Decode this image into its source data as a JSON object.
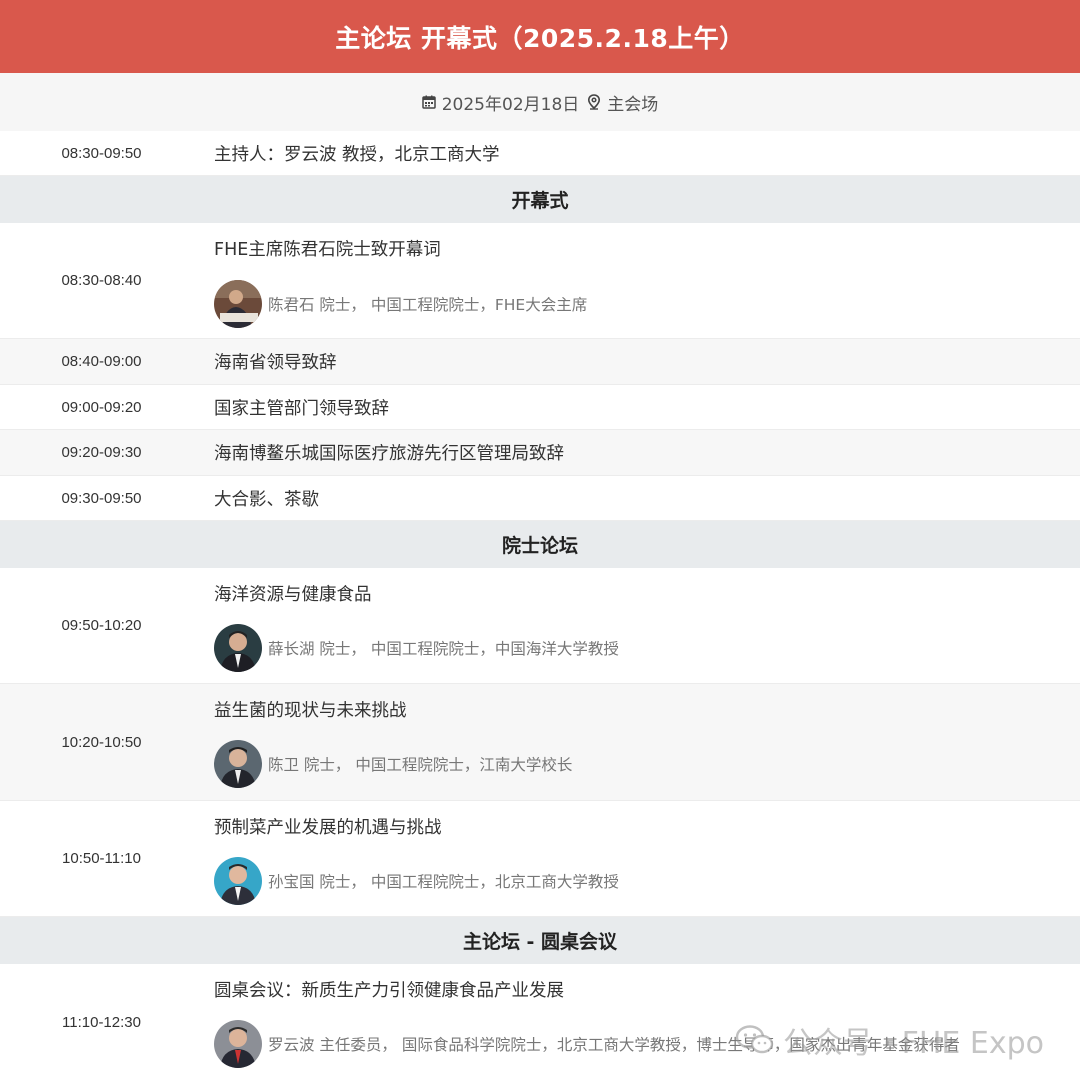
{
  "header": {
    "title": "主论坛 开幕式（2025.2.18上午）"
  },
  "meta": {
    "date": "2025年02月18日",
    "location": "主会场",
    "calendar_icon": "calendar-icon",
    "location_icon": "map-pin-icon"
  },
  "host_row": {
    "time": "08:30-09:50",
    "text": "主持人：罗云波 教授，北京工商大学"
  },
  "sections": {
    "opening": "开幕式",
    "academician": "院士论坛",
    "roundtable": "主论坛 - 圆桌会议"
  },
  "opening_items": [
    {
      "time": "08:30-08:40",
      "topic": "FHE主席陈君石院士致开幕词",
      "speaker": "陈君石 院士，  中国工程院院士，FHE大会主席"
    },
    {
      "time": "08:40-09:00",
      "topic": "海南省领导致辞"
    },
    {
      "time": "09:00-09:20",
      "topic": "国家主管部门领导致辞"
    },
    {
      "time": "09:20-09:30",
      "topic": "海南博鳌乐城国际医疗旅游先行区管理局致辞"
    },
    {
      "time": "09:30-09:50",
      "topic": "大合影、茶歇"
    }
  ],
  "academician_items": [
    {
      "time": "09:50-10:20",
      "topic": "海洋资源与健康食品",
      "speaker": "薛长湖 院士，  中国工程院院士，中国海洋大学教授"
    },
    {
      "time": "10:20-10:50",
      "topic": "益生菌的现状与未来挑战",
      "speaker": "陈卫 院士，  中国工程院院士，江南大学校长"
    },
    {
      "time": "10:50-11:10",
      "topic": "预制菜产业发展的机遇与挑战",
      "speaker": "孙宝国 院士，  中国工程院院士，北京工商大学教授"
    }
  ],
  "roundtable_items": [
    {
      "time": "11:10-12:30",
      "topic": "圆桌会议：新质生产力引领健康食品产业发展",
      "speaker": "罗云波 主任委员，  国际食品科学院院士，北京工商大学教授，博士生导师，国家杰出青年基金获得者"
    }
  ],
  "watermark": {
    "text": "公众号 · FHE Expo",
    "icon": "wechat-icon"
  },
  "colors": {
    "banner": "#d9584c",
    "section_bg": "#e8ebed",
    "row_alt": "#f7f7f7"
  }
}
